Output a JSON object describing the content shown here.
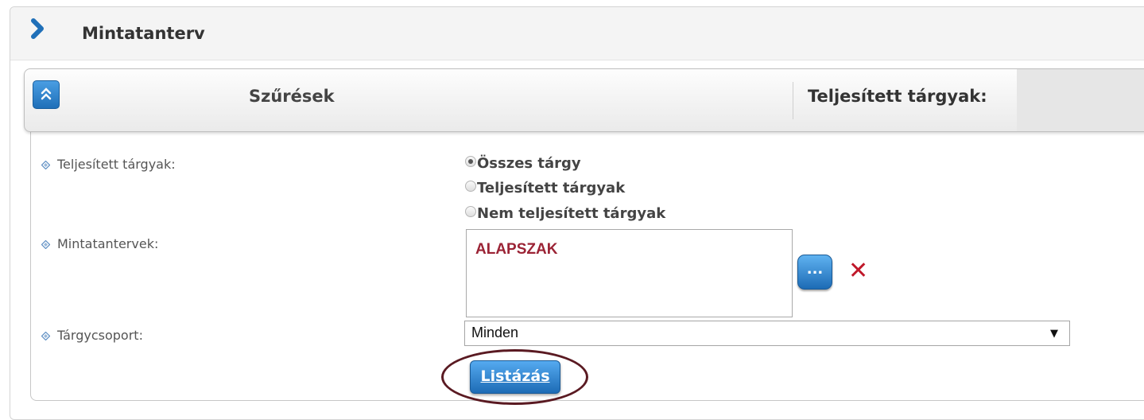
{
  "page": {
    "title": "Mintatanterv"
  },
  "filters": {
    "title": "Szűrések",
    "header_label": "Teljesített tárgyak:",
    "completed_label": "Teljesített tárgyak:",
    "radio_options": [
      {
        "label": "Összes tárgy",
        "checked": true
      },
      {
        "label": "Teljesített tárgyak",
        "checked": false
      },
      {
        "label": "Nem teljesített tárgyak",
        "checked": false
      }
    ],
    "curricula_label": "Mintatantervek:",
    "curricula_items": [
      "ALAPSZAK"
    ],
    "browse_label": "...",
    "remove_label": "✕",
    "subject_group_label": "Tárgycsoport:",
    "subject_group_value": "Minden",
    "list_button": "Listázás"
  },
  "colors": {
    "accent_blue": "#1d6bb5",
    "list_item_red": "#9b2335",
    "remove_red": "#c0182a",
    "ellipse": "#5a1a22"
  },
  "icons": {
    "title": "chevron-right-icon",
    "collapse": "double-chevron-up-icon",
    "bullet": "diamond-bullet-icon",
    "select": "dropdown-arrow-icon"
  }
}
